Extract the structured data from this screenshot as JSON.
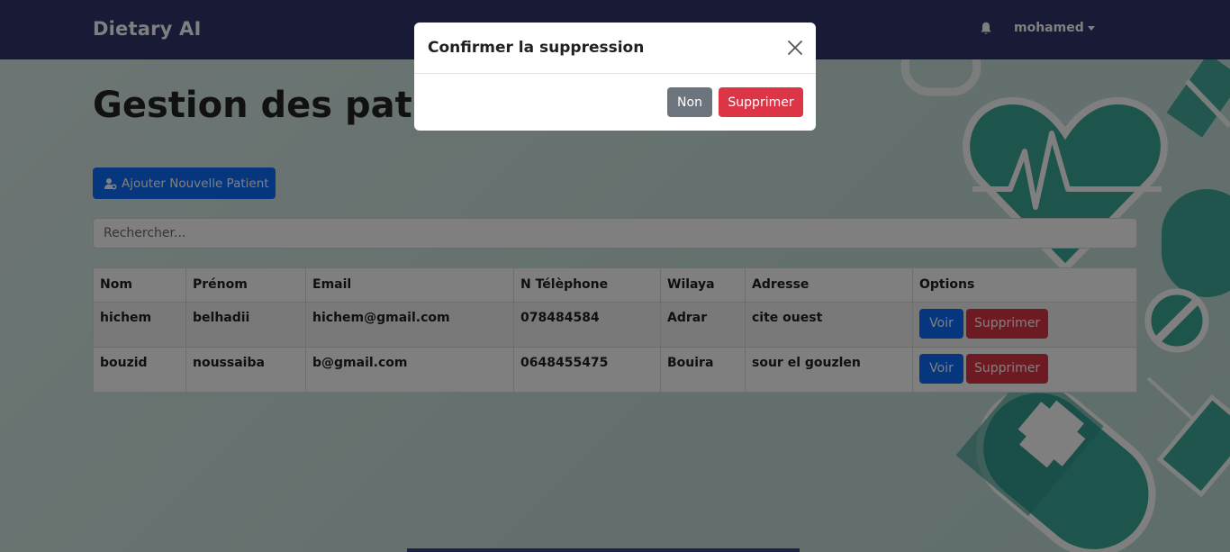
{
  "navbar": {
    "brand": "Dietary AI",
    "user": "mohamed"
  },
  "main": {
    "title": "Gestion des patients",
    "add_button": "Ajouter Nouvelle Patient",
    "search_placeholder": "Rechercher...",
    "table": {
      "headers": [
        "Nom",
        "Prénom",
        "Email",
        "N Télèphone",
        "Wilaya",
        "Adresse",
        "Options"
      ],
      "rows": [
        {
          "nom": "hichem",
          "prenom": "belhadii",
          "email": "hichem@gmail.com",
          "telephone": "078484584",
          "wilaya": "Adrar",
          "adresse": "cite ouest"
        },
        {
          "nom": "bouzid",
          "prenom": "noussaiba",
          "email": "b@gmail.com",
          "telephone": "0648455475",
          "wilaya": "Bouira",
          "adresse": "sour el gouzlen"
        }
      ],
      "view_label": "Voir",
      "delete_label": "Supprimer"
    }
  },
  "modal": {
    "title": "Confirmer la suppression",
    "cancel_label": "Non",
    "confirm_label": "Supprimer"
  },
  "colors": {
    "navbar": "#32356d",
    "primary": "#0d6efd",
    "danger": "#dc3545",
    "secondary": "#6c757d",
    "decor": "#3aa899"
  }
}
